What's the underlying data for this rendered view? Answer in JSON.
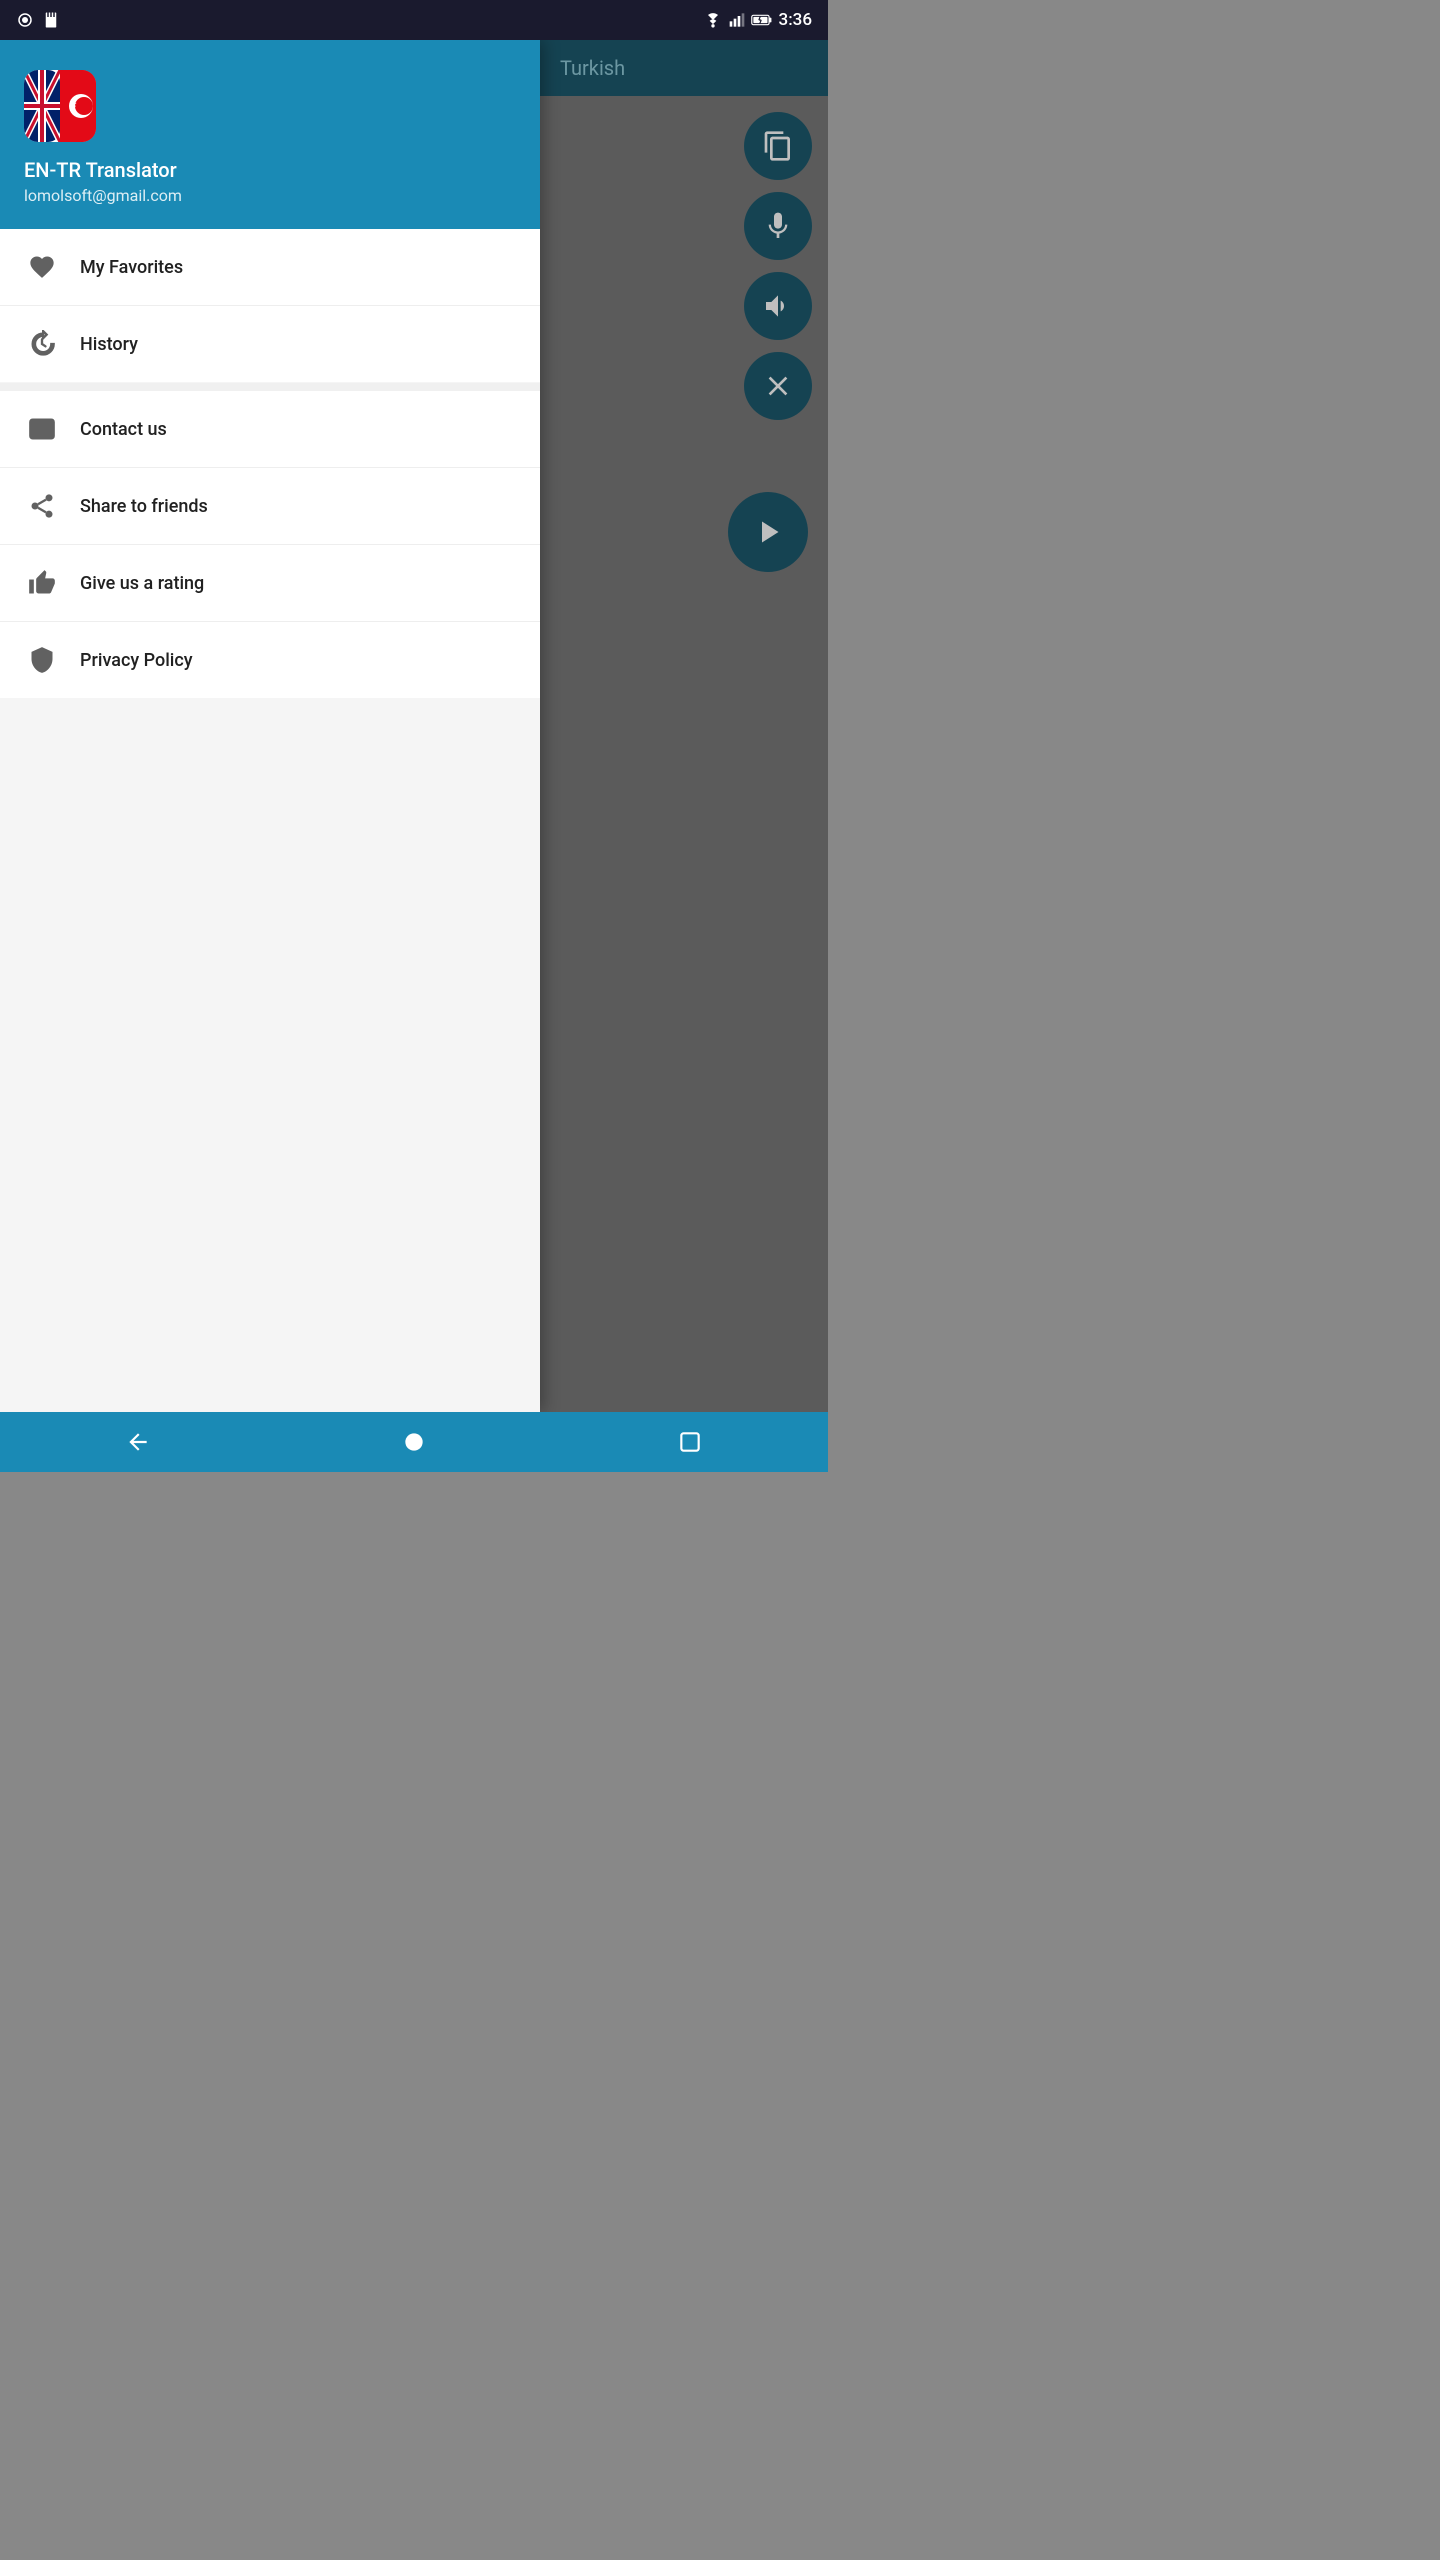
{
  "statusBar": {
    "time": "3:36"
  },
  "drawer": {
    "header": {
      "appName": "EN-TR Translator",
      "email": "lomolsoft@gmail.com"
    },
    "menuSections": [
      {
        "items": [
          {
            "id": "favorites",
            "label": "My Favorites",
            "icon": "heart"
          },
          {
            "id": "history",
            "label": "History",
            "icon": "clock"
          }
        ]
      },
      {
        "items": [
          {
            "id": "contact",
            "label": "Contact us",
            "icon": "envelope"
          },
          {
            "id": "share",
            "label": "Share to friends",
            "icon": "share"
          },
          {
            "id": "rating",
            "label": "Give us a rating",
            "icon": "thumbsup"
          },
          {
            "id": "privacy",
            "label": "Privacy Policy",
            "icon": "shield"
          }
        ]
      }
    ]
  },
  "rightPanel": {
    "headerTitle": "Turkish"
  },
  "bottomNav": {
    "back": "back",
    "home": "home",
    "recent": "recent"
  }
}
